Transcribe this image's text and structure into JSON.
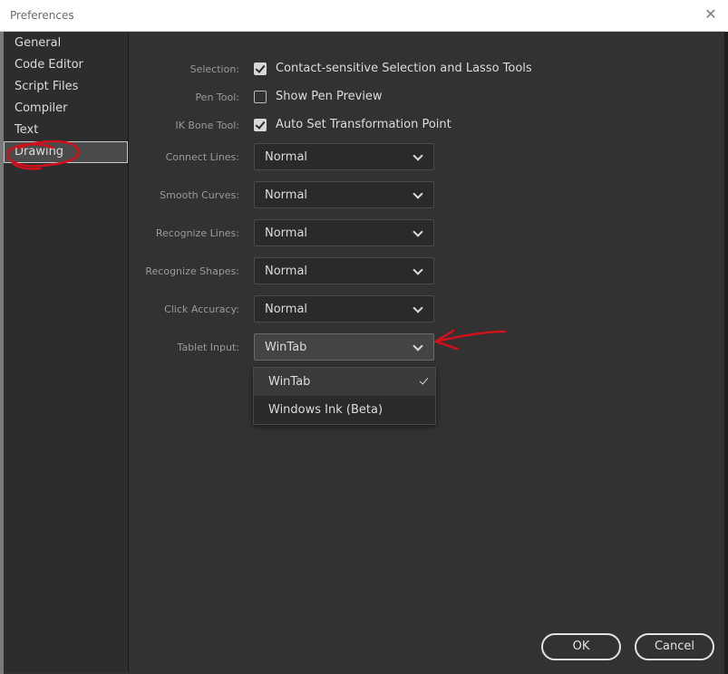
{
  "window": {
    "title": "Preferences",
    "close_icon": "close-icon"
  },
  "sidebar": {
    "items": [
      {
        "label": "General"
      },
      {
        "label": "Code Editor"
      },
      {
        "label": "Script Files"
      },
      {
        "label": "Compiler"
      },
      {
        "label": "Text"
      },
      {
        "label": "Drawing",
        "active": true
      }
    ]
  },
  "options": {
    "selection": {
      "label": "Selection:",
      "checked": true,
      "text": "Contact-sensitive Selection and Lasso Tools"
    },
    "pen_tool": {
      "label": "Pen Tool:",
      "checked": false,
      "text": "Show Pen Preview"
    },
    "ik_bone_tool": {
      "label": "IK Bone Tool:",
      "checked": true,
      "text": "Auto Set Transformation Point"
    },
    "connect_lines": {
      "label": "Connect Lines:",
      "value": "Normal"
    },
    "smooth_curves": {
      "label": "Smooth Curves:",
      "value": "Normal"
    },
    "recognize_lines": {
      "label": "Recognize Lines:",
      "value": "Normal"
    },
    "recognize_shapes": {
      "label": "Recognize Shapes:",
      "value": "Normal"
    },
    "click_accuracy": {
      "label": "Click Accuracy:",
      "value": "Normal"
    },
    "tablet_input": {
      "label": "Tablet Input:",
      "value": "WinTab",
      "options": [
        "WinTab",
        "Windows Ink (Beta)"
      ]
    }
  },
  "footer": {
    "ok_label": "OK",
    "cancel_label": "Cancel"
  },
  "colors": {
    "background": "#323232",
    "sidebar": "#2d2d2d",
    "annotation": "#d0101a"
  }
}
